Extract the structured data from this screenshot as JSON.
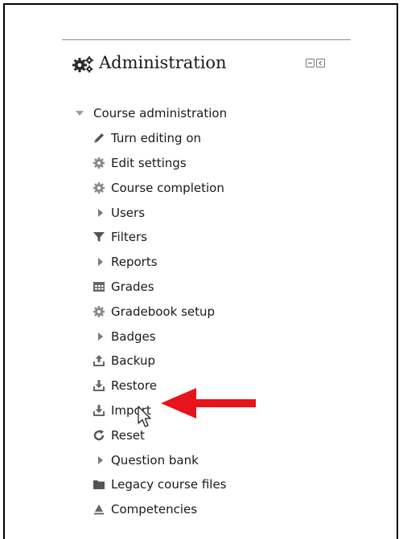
{
  "block": {
    "title": "Administration",
    "title_icon": "gears-icon",
    "controls": [
      "dock-minus-icon",
      "move-left-icon"
    ]
  },
  "tree": {
    "root": {
      "label": "Course administration",
      "icon": "caret-down-icon"
    },
    "items": [
      {
        "label": "Turn editing on",
        "icon": "pencil-icon"
      },
      {
        "label": "Edit settings",
        "icon": "cog-icon"
      },
      {
        "label": "Course completion",
        "icon": "cog-icon"
      },
      {
        "label": "Users",
        "icon": "caret-right-icon"
      },
      {
        "label": "Filters",
        "icon": "filter-icon"
      },
      {
        "label": "Reports",
        "icon": "caret-right-icon"
      },
      {
        "label": "Grades",
        "icon": "table-icon"
      },
      {
        "label": "Gradebook setup",
        "icon": "cog-icon"
      },
      {
        "label": "Badges",
        "icon": "caret-right-icon"
      },
      {
        "label": "Backup",
        "icon": "upload-icon"
      },
      {
        "label": "Restore",
        "icon": "download-icon"
      },
      {
        "label": "Import",
        "icon": "download-icon"
      },
      {
        "label": "Reset",
        "icon": "reset-icon"
      },
      {
        "label": "Question bank",
        "icon": "caret-right-icon"
      },
      {
        "label": "Legacy course files",
        "icon": "folder-icon"
      },
      {
        "label": "Competencies",
        "icon": "competencies-icon"
      }
    ]
  },
  "annotation": {
    "arrow_color": "#e8131b",
    "target": "Import"
  }
}
